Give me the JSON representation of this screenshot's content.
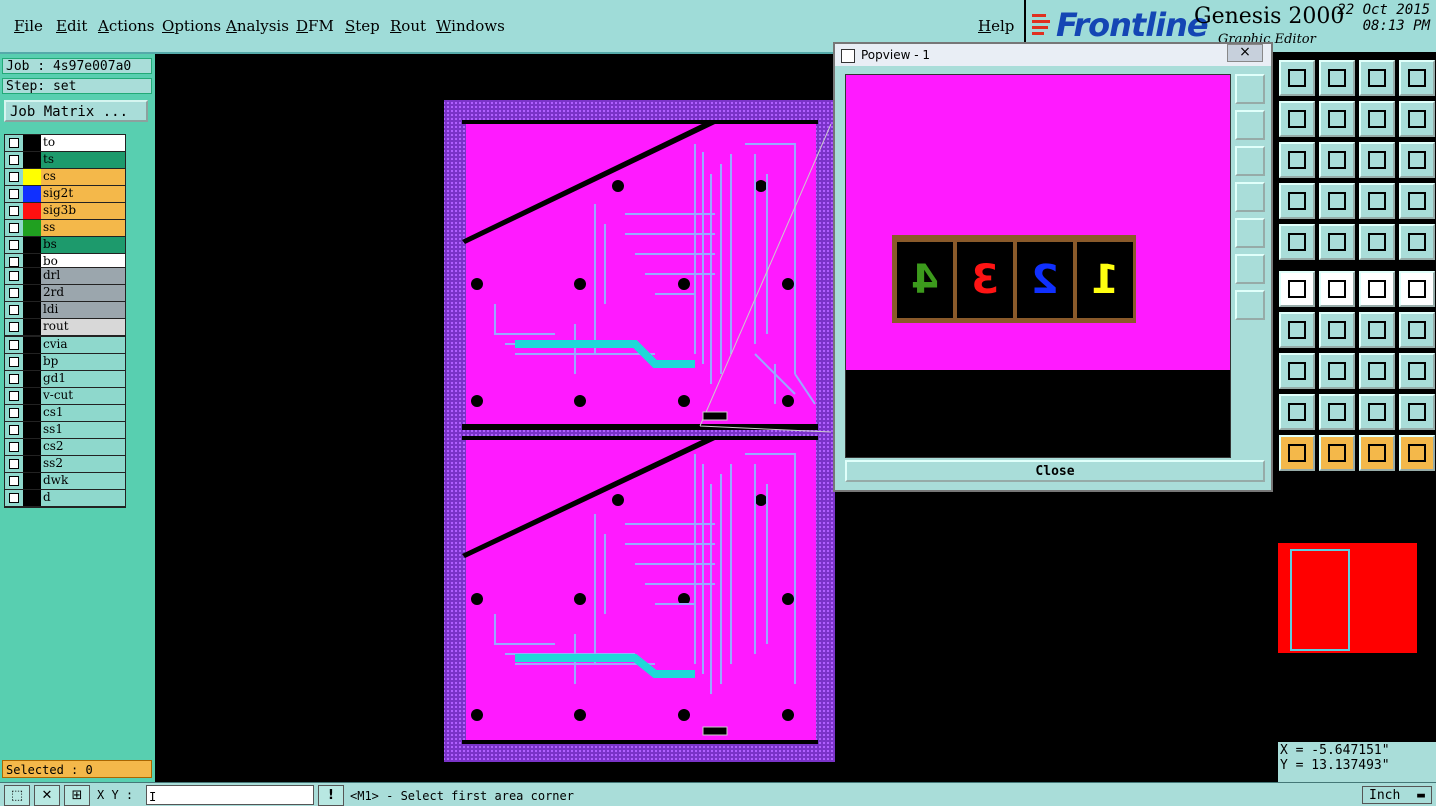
{
  "menu": [
    "File",
    "Edit",
    "Actions",
    "Options",
    "Analysis",
    "DFM",
    "Step",
    "Rout",
    "Windows"
  ],
  "help": "Help",
  "brand": {
    "logo": "Frontline",
    "product": "Genesis 2000",
    "subtitle": "Graphic Editor",
    "date": "22 Oct 2015",
    "time": "08:13 PM"
  },
  "job": {
    "job_label": "Job : 4s97e007a0",
    "step_label": "Step: set",
    "matrix_button": "Job Matrix ..."
  },
  "layers": {
    "group1": [
      {
        "name": "to",
        "swatch": "#000000",
        "bg": "#ffffff"
      },
      {
        "name": "ts",
        "swatch": "#000000",
        "bg": "#1d9a6c"
      },
      {
        "name": "cs",
        "swatch": "#ffff00",
        "bg": "#f4b84a"
      },
      {
        "name": "sig2t",
        "swatch": "#1030ff",
        "bg": "#f4b84a"
      },
      {
        "name": "sig3b",
        "swatch": "#ff1010",
        "bg": "#f4b84a"
      },
      {
        "name": "ss",
        "swatch": "#20a020",
        "bg": "#f4b84a"
      },
      {
        "name": "bs",
        "swatch": "#000000",
        "bg": "#1d9a6c"
      },
      {
        "name": "bo",
        "swatch": "#000000",
        "bg": "#ffffff"
      }
    ],
    "group2": [
      {
        "name": "drl",
        "swatch": "#000000",
        "bg": "#9ba6ad"
      },
      {
        "name": "2rd",
        "swatch": "#000000",
        "bg": "#9ba6ad"
      },
      {
        "name": "ldi",
        "swatch": "#000000",
        "bg": "#9ba6ad"
      },
      {
        "name": "rout",
        "swatch": "#000000",
        "bg": "#d8d8d8"
      }
    ],
    "group3": [
      {
        "name": "cvia",
        "swatch": "#000000",
        "bg": "#8ed8cc"
      },
      {
        "name": "bp",
        "swatch": "#000000",
        "bg": "#8ed8cc"
      },
      {
        "name": "gd1",
        "swatch": "#000000",
        "bg": "#8ed8cc"
      },
      {
        "name": "v-cut",
        "swatch": "#000000",
        "bg": "#8ed8cc"
      },
      {
        "name": "cs1",
        "swatch": "#000000",
        "bg": "#8ed8cc"
      },
      {
        "name": "ss1",
        "swatch": "#000000",
        "bg": "#8ed8cc"
      },
      {
        "name": "cs2",
        "swatch": "#000000",
        "bg": "#8ed8cc"
      },
      {
        "name": "ss2",
        "swatch": "#000000",
        "bg": "#8ed8cc"
      },
      {
        "name": "dwk",
        "swatch": "#000000",
        "bg": "#8ed8cc"
      },
      {
        "name": "d",
        "swatch": "#000000",
        "bg": "#8ed8cc"
      }
    ]
  },
  "selected": "Selected : 0",
  "status": {
    "xy_label": "X Y :",
    "xy_value": "I",
    "excl": "!",
    "message": "<M1> - Select first area corner",
    "units": "Inch"
  },
  "coords": {
    "x": "X = -5.647151\"",
    "y": "Y = 13.137493\""
  },
  "popview": {
    "title": "Popview - 1",
    "close": "Close",
    "close_x": "×",
    "digits": [
      {
        "text": "4",
        "color": "#3c9a1c"
      },
      {
        "text": "3",
        "color": "#ff1414"
      },
      {
        "text": "2",
        "color": "#1030ff"
      },
      {
        "text": "1",
        "color": "#ffff10"
      }
    ]
  },
  "colors": {
    "panel": "#a9ddd9",
    "board": "#ff1aff",
    "trace": "#9aa8ff",
    "mask": "#7a33c8"
  }
}
